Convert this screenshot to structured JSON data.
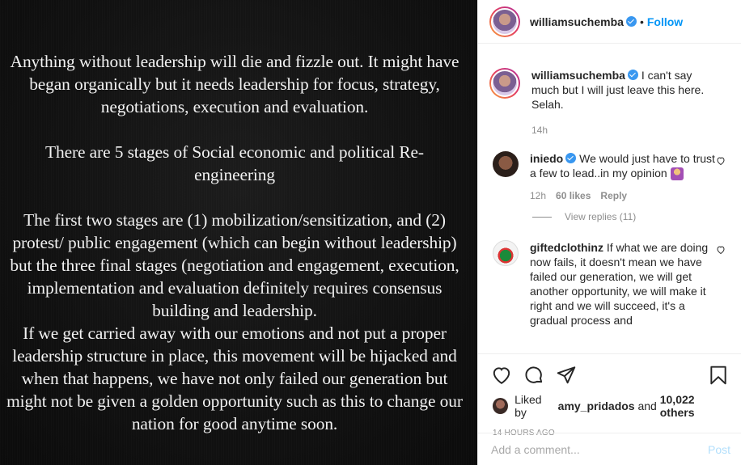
{
  "post_image": {
    "paragraphs": [
      "Anything without leadership will die and fizzle out. It might have\nbegan organically but it needs leadership for focus, strategy,\nnegotiations, execution and evaluation.",
      "There are 5 stages of Social economic and political Re-\nengineering",
      "The first two stages are  (1) mobilization/sensitization, and (2)\nprotest/ public engagement (which can begin without leadership)\nbut the three final stages (negotiation and engagement, execution,\nimplementation and evaluation definitely requires consensus\nbuilding and leadership.\nIf we get carried away with our emotions and not put a proper\nleadership structure in place, this movement will be hijacked and\nwhen that happens, we have not only failed our generation but\nmight not be given a golden opportunity such as this to change our\nnation for good anytime soon."
    ]
  },
  "header": {
    "username": "williamsuchemba",
    "separator": "•",
    "follow_label": "Follow"
  },
  "caption": {
    "username": "williamsuchemba",
    "text": "I can't say much but I will just leave this here. Selah.",
    "time": "14h"
  },
  "comments": [
    {
      "username": "iniedo",
      "text": "We would just have to trust a few to lead..in my opinion",
      "time": "12h",
      "likes": "60 likes",
      "reply_label": "Reply",
      "view_replies": "View replies (11)"
    },
    {
      "username": "giftedclothinz",
      "text": "If what we are doing now fails, it doesn't mean we have failed our generation, we will get another opportunity, we will make it right and we will succeed, it's a gradual process and"
    }
  ],
  "likes": {
    "prefix": "Liked by",
    "user": "amy_pridados",
    "conjunction": "and",
    "count": "10,022 others"
  },
  "timestamp": "14 HOURS AGO",
  "add_comment": {
    "placeholder": "Add a comment...",
    "post_label": "Post"
  },
  "colors": {
    "accent": "#0095f6",
    "verified": "#3897f0",
    "muted": "#8e8e8e"
  }
}
